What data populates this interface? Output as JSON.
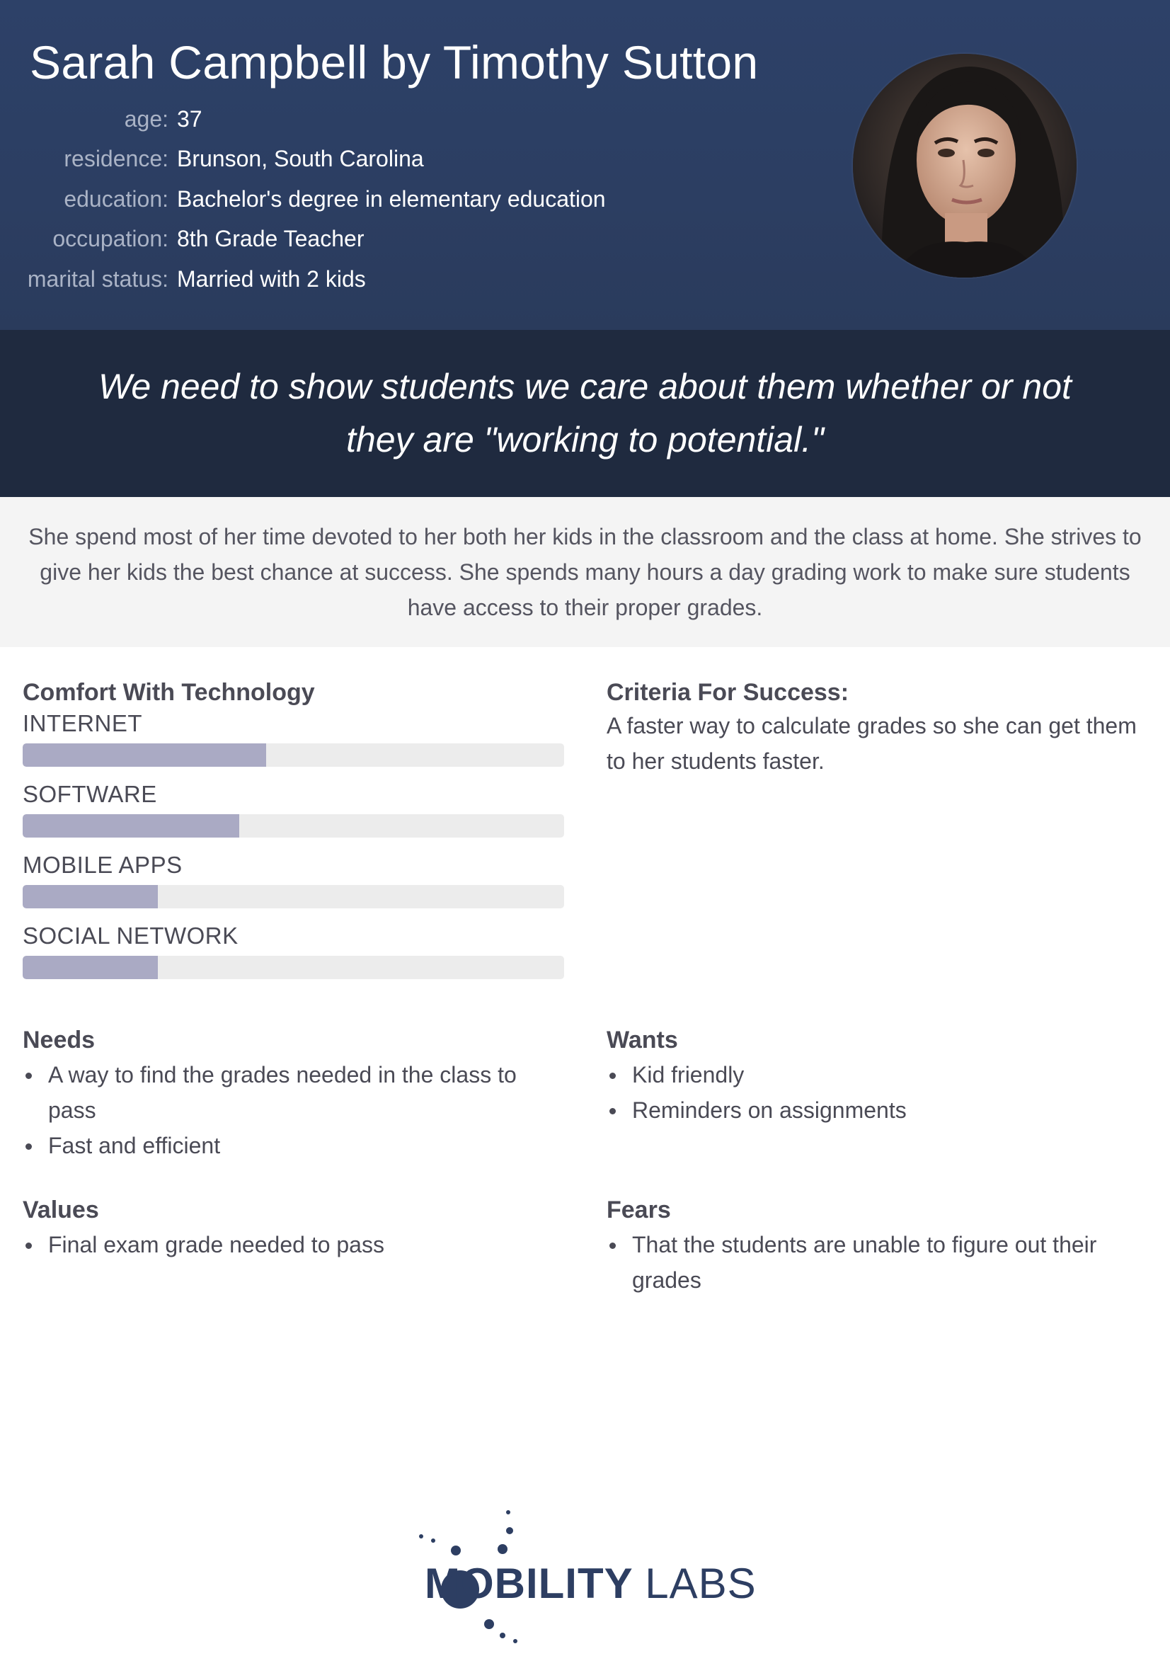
{
  "header": {
    "title": "Sarah Campbell by Timothy Sutton",
    "details": [
      {
        "label": "age:",
        "value": "37"
      },
      {
        "label": "residence:",
        "value": "Brunson, South Carolina"
      },
      {
        "label": "education:",
        "value": "Bachelor's degree in elementary education"
      },
      {
        "label": "occupation:",
        "value": "8th Grade Teacher"
      },
      {
        "label": "marital status:",
        "value": "Married with 2 kids"
      }
    ],
    "portrait_icon": "portrait-photo"
  },
  "quote": "We need to show students we care about them whether or not they are \"working to potential.\"",
  "bio": "She spend most of her time devoted to her both her kids in the classroom and the class at home. She strives to give her kids the best chance at success. She spends many hours a day grading work to make sure students have access to their proper grades.",
  "tech": {
    "title": "Comfort With Technology",
    "items": [
      {
        "label": "INTERNET",
        "level": 0.45
      },
      {
        "label": "SOFTWARE",
        "level": 0.4
      },
      {
        "label": "MOBILE APPS",
        "level": 0.25
      },
      {
        "label": "SOCIAL NETWORK",
        "level": 0.25
      }
    ]
  },
  "criteria": {
    "title": "Criteria For Success:",
    "text": "A faster way to calculate grades so she can get them to her students faster."
  },
  "needs": {
    "title": "Needs",
    "items": [
      "A way to find the grades needed in the class to pass",
      "Fast and efficient"
    ]
  },
  "wants": {
    "title": "Wants",
    "items": [
      "Kid friendly",
      "Reminders on assignments"
    ]
  },
  "values": {
    "title": "Values",
    "items": [
      "Final exam grade needed to pass"
    ]
  },
  "fears": {
    "title": "Fears",
    "items": [
      "That the students are unable to figure out their grades"
    ]
  },
  "logo": {
    "brand": "MOBILITY",
    "suffix": "LABS"
  },
  "colors": {
    "header_bg": "#2c3e62",
    "quote_bg": "#1f2a3f",
    "bio_bg": "#f4f4f4",
    "bar_fill": "#aaaac4",
    "bar_track": "#ececec",
    "logo": "#2d3e62"
  }
}
